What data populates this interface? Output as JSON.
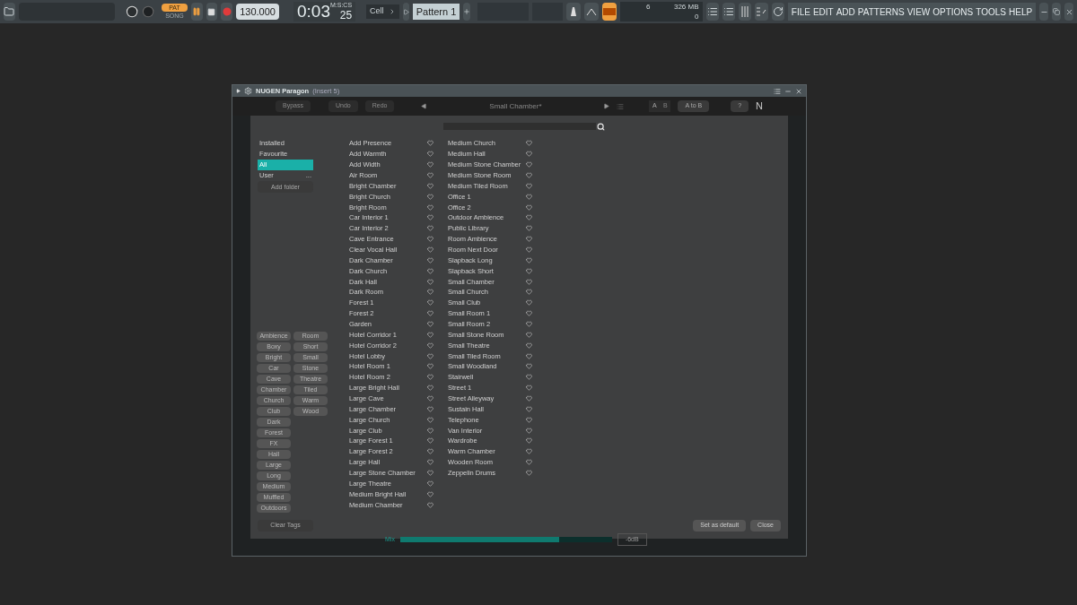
{
  "toolbar": {
    "transport_mode": [
      {
        "label": "PAT",
        "selected": true
      },
      {
        "label": "SONG",
        "selected": false
      }
    ],
    "tempo": "130.000",
    "time": "0:03",
    "time_cs": "25",
    "time_format": "M:S:CS",
    "snap": "Cell",
    "pattern": "Pattern 1",
    "cpu": "6",
    "memory": "326 MB",
    "polyphony": "0",
    "menu": [
      "FILE",
      "EDIT",
      "ADD",
      "PATTERNS",
      "VIEW",
      "OPTIONS",
      "TOOLS",
      "HELP"
    ]
  },
  "plugin": {
    "title": "NUGEN Paragon",
    "insert": "(Insert 5)",
    "buttons": [
      {
        "label": "Bypass",
        "disabled": true
      },
      {
        "label": "Undo",
        "disabled": true
      },
      {
        "label": "Redo",
        "disabled": true
      }
    ],
    "preset": "Small Chamber*",
    "ab": [
      {
        "label": "A",
        "selected": true
      },
      {
        "label": "B",
        "selected": false
      }
    ],
    "a_to_b": "A to B",
    "help": "?",
    "logo": "N",
    "browser": {
      "folders": [
        {
          "label": "Installed",
          "selected": false
        },
        {
          "label": "Favourite",
          "selected": false
        },
        {
          "label": "All",
          "selected": true
        },
        {
          "label": "User",
          "selected": false,
          "more": "..."
        }
      ],
      "add_folder": "Add folder",
      "tags": [
        [
          {
            "label": "Ambience",
            "selected": false
          },
          {
            "label": "Boxy",
            "selected": false
          },
          {
            "label": "Bright",
            "selected": false
          },
          {
            "label": "Car",
            "selected": false
          },
          {
            "label": "Cave",
            "selected": false
          },
          {
            "label": "Chamber",
            "selected": false
          },
          {
            "label": "Church",
            "selected": false
          },
          {
            "label": "Club",
            "selected": false
          },
          {
            "label": "Dark",
            "selected": false
          },
          {
            "label": "Forest",
            "selected": false
          },
          {
            "label": "FX",
            "selected": false
          },
          {
            "label": "Hall",
            "selected": false
          },
          {
            "label": "Large",
            "selected": false
          },
          {
            "label": "Long",
            "selected": false
          },
          {
            "label": "Medium",
            "selected": false
          },
          {
            "label": "Muffled",
            "selected": false
          },
          {
            "label": "Outdoors",
            "selected": false
          }
        ],
        [
          {
            "label": "Room",
            "selected": false
          },
          {
            "label": "Short",
            "selected": false
          },
          {
            "label": "Small",
            "selected": false
          },
          {
            "label": "Stone",
            "selected": false
          },
          {
            "label": "Theatre",
            "selected": false
          },
          {
            "label": "Tiled",
            "selected": false
          },
          {
            "label": "Warm",
            "selected": false
          },
          {
            "label": "Wood",
            "selected": false
          }
        ]
      ],
      "preset_columns": [
        [
          "Add Presence",
          "Add Warmth",
          "Add Width",
          "Air Room",
          "Bright Chamber",
          "Bright Church",
          "Bright Room",
          "Car Interior 1",
          "Car Interior 2",
          "Cave Entrance",
          "Clear Vocal Hall",
          "Dark Chamber",
          "Dark Church",
          "Dark Hall",
          "Dark Room",
          "Forest 1",
          "Forest 2",
          "Garden",
          "Hotel Corridor 1",
          "Hotel Corridor 2",
          "Hotel Lobby",
          "Hotel Room 1",
          "Hotel Room 2",
          "Large Bright Hall",
          "Large Cave",
          "Large Chamber",
          "Large Church",
          "Large Club",
          "Large Forest 1",
          "Large Forest 2",
          "Large Hall",
          "Large Stone Chamber",
          "Large Theatre",
          "Medium Bright Hall",
          "Medium Chamber"
        ],
        [
          "Medium Church",
          "Medium Hall",
          "Medium Stone Chamber",
          "Medium Stone Room",
          "Medium Tiled Room",
          "Office 1",
          "Office 2",
          "Outdoor Ambience",
          "Public Library",
          "Room Ambience",
          "Room Next Door",
          "Slapback Long",
          "Slapback Short",
          "Small Chamber",
          "Small Church",
          "Small Club",
          "Small Room 1",
          "Small Room 2",
          "Small Stone Room",
          "Small Theatre",
          "Small Tiled Room",
          "Small Woodland",
          "Stairwell",
          "Street 1",
          "Street Alleyway",
          "Sustain Hall",
          "Telephone",
          "Van Interior",
          "Wardrobe",
          "Warm Chamber",
          "Wooden Room",
          "Zeppelin Drums"
        ]
      ],
      "clear_tags": "Clear Tags",
      "set_default": "Set as default",
      "close": "Close"
    },
    "mix": {
      "label": "Mix",
      "level": 0.75,
      "reading": "-6dB"
    }
  }
}
